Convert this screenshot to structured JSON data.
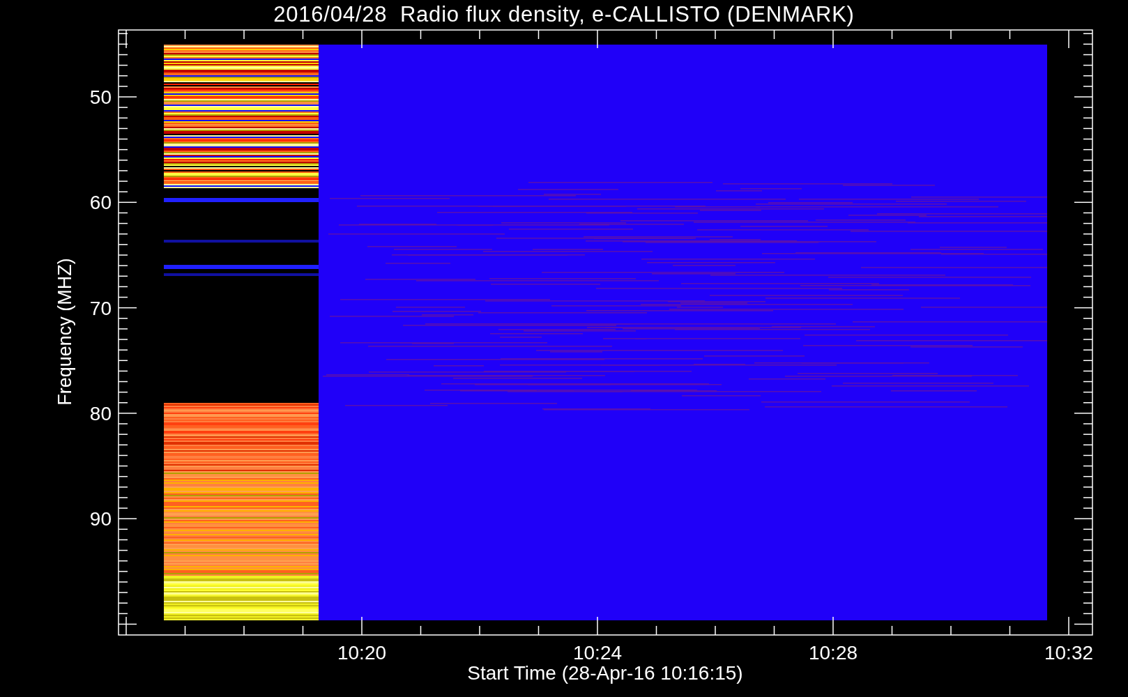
{
  "title": "2016/04/28  Radio flux density, e-CALLISTO (DENMARK)",
  "y_axis": {
    "label": "Frequency (MHZ)",
    "ticks": [
      "50",
      "60",
      "70",
      "80",
      "90"
    ]
  },
  "x_axis": {
    "label": "Start Time (28-Apr-16 10:16:15)",
    "ticks": [
      "10:20",
      "10:24",
      "10:28",
      "10:32"
    ]
  }
}
